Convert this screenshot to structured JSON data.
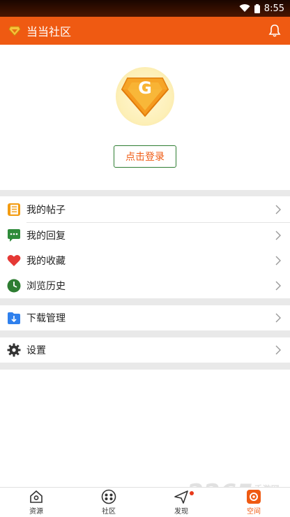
{
  "status_bar": {
    "time": "8:55"
  },
  "app_bar": {
    "title": "当当社区"
  },
  "profile": {
    "badge_letter": "G",
    "login_label": "点击登录"
  },
  "menu_group1": [
    {
      "label": "我的帖子",
      "icon": "posts-icon",
      "color": "#f39c12"
    },
    {
      "label": "我的回复",
      "icon": "reply-icon",
      "color": "#2e8b3a"
    },
    {
      "label": "我的收藏",
      "icon": "heart-icon",
      "color": "#e53935"
    },
    {
      "label": "浏览历史",
      "icon": "clock-icon",
      "color": "#2e7d32"
    }
  ],
  "menu_group2": [
    {
      "label": "下载管理",
      "icon": "download-icon",
      "color": "#2f80ed"
    }
  ],
  "menu_group3": [
    {
      "label": "设置",
      "icon": "gear-icon",
      "color": "#333333"
    }
  ],
  "tab_bar": [
    {
      "label": "资源",
      "icon": "home-icon"
    },
    {
      "label": "社区",
      "icon": "community-icon"
    },
    {
      "label": "发现",
      "icon": "discover-icon"
    },
    {
      "label": "空间",
      "icon": "space-icon",
      "active": true
    }
  ],
  "watermark": {
    "text": "2265",
    "sub": "手游网"
  },
  "colors": {
    "accent": "#ef5a12",
    "separator": "#e9e9e9",
    "login_border": "#2e7d32"
  }
}
